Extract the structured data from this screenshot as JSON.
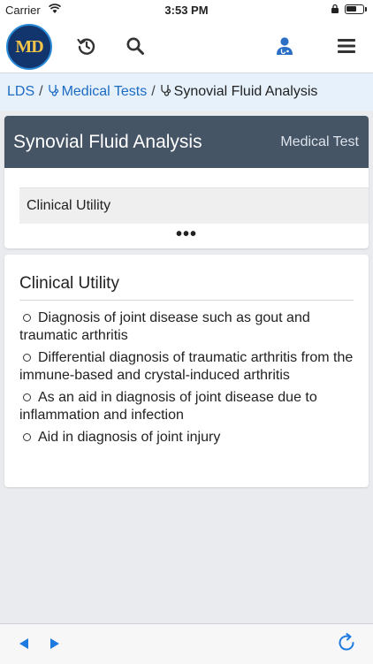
{
  "status_bar": {
    "carrier": "Carrier",
    "time": "3:53 PM"
  },
  "app": {
    "logo_text": "MD",
    "icons": [
      "history-icon",
      "search-icon",
      "doctor-icon",
      "menu-icon"
    ],
    "accent_color": "#1d6bc4"
  },
  "breadcrumb": {
    "items": [
      {
        "label": "LDS"
      },
      {
        "label": "Medical Tests",
        "icon": "stethoscope-icon"
      },
      {
        "label": "Synovial Fluid Analysis",
        "icon": "stethoscope-icon"
      }
    ]
  },
  "header": {
    "title": "Synovial Fluid Analysis",
    "type_label": "Medical Test",
    "header_color": "#465566"
  },
  "sections": {
    "active_tab": "Clinical Utility",
    "more": "•••"
  },
  "content": {
    "heading": "Clinical Utility",
    "bullets": [
      "Diagnosis of joint disease such as gout and traumatic arthritis",
      "Differential diagnosis of traumatic arthritis from the immune-based and crystal-induced arthritis",
      "As an aid in diagnosis of joint disease due to inflammation and infection",
      "Aid in diagnosis of joint injury"
    ]
  },
  "toolbar": {
    "icons": [
      "back-arrow-icon",
      "forward-arrow-icon",
      "refresh-icon"
    ]
  }
}
